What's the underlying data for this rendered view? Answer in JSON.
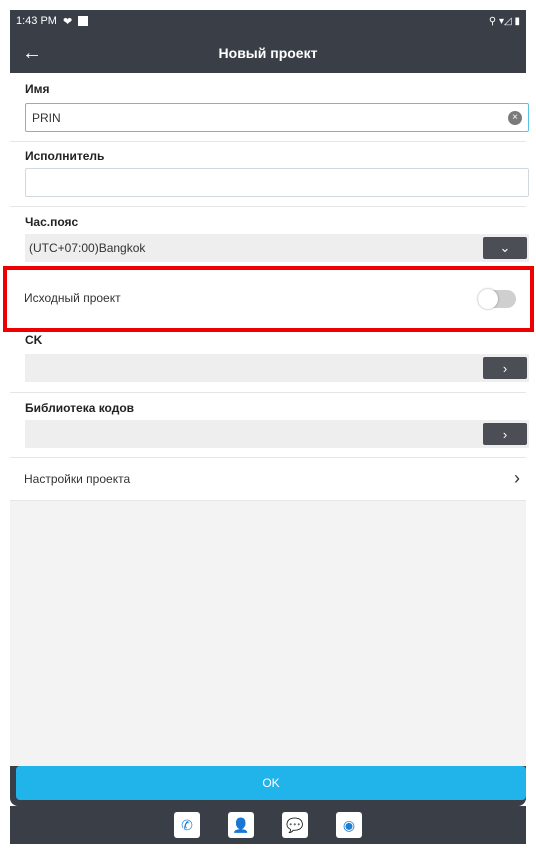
{
  "status_bar": {
    "time": "1:43 PM",
    "right_icons": "⚲ ▾◿ ▮"
  },
  "header": {
    "title": "Новый проект",
    "back_icon": "←"
  },
  "form": {
    "name_label": "Имя",
    "name_value": "PRIN",
    "executor_label": "Исполнитель",
    "executor_value": "",
    "timezone_label": "Час.пояс",
    "timezone_value": "(UTC+07:00)Bangkok",
    "source_project_label": "Исходный проект",
    "source_project_enabled": false,
    "ck_label": "CK",
    "ck_value": "",
    "code_library_label": "Библиотека кодов",
    "code_library_value": ""
  },
  "settings": {
    "label": "Настройки проекта"
  },
  "ok_button": {
    "label": "OK"
  },
  "taskbar": {
    "icons": [
      "phone-icon",
      "contacts-icon",
      "chat-icon",
      "camera-icon"
    ]
  },
  "colors": {
    "accent": "#20b4ea",
    "highlight": "#ee0000",
    "dark_bar": "#3a3f47"
  }
}
